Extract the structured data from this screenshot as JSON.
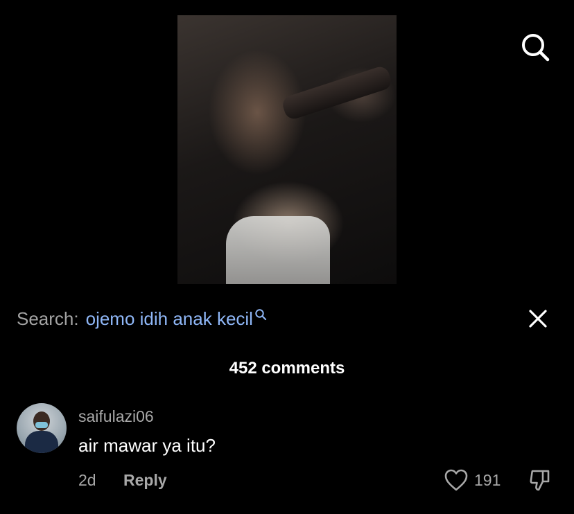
{
  "search": {
    "prefix": "Search:",
    "query": "ojemo idih anak kecil"
  },
  "comments": {
    "count_label": "452 comments",
    "items": [
      {
        "username": "saifulazi06",
        "text": "air mawar ya itu?",
        "time": "2d",
        "reply_label": "Reply",
        "likes": "191"
      }
    ]
  },
  "icons": {
    "top_search": "search-icon",
    "query_search": "search-small-icon",
    "close": "close-icon",
    "like": "heart-icon",
    "dislike": "thumbs-down-icon"
  },
  "colors": {
    "background": "#000000",
    "query": "#8fb7f7",
    "muted": "#a8a8a8",
    "text": "#ffffff"
  }
}
